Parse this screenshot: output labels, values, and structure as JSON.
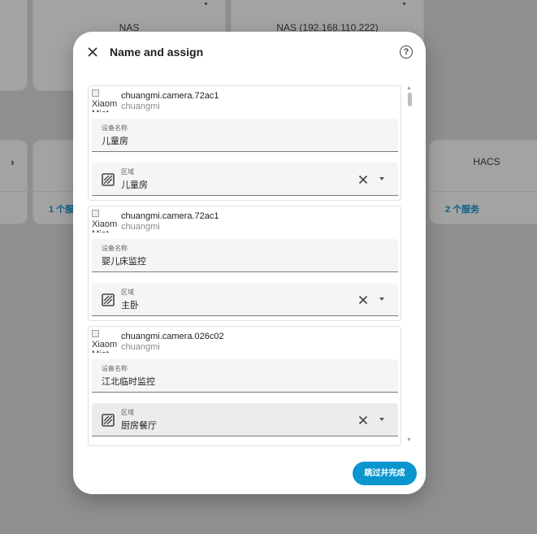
{
  "background": {
    "cards": [
      {
        "title": "NAS"
      },
      {
        "title": "NAS (192.168.110.222)"
      },
      {
        "title": "HACS",
        "link": "2 个服务"
      }
    ],
    "partial_link": "1 个服"
  },
  "dialog": {
    "title": "Name and assign",
    "close_icon": "close-icon",
    "help_icon": "help-icon",
    "help_glyph": "?",
    "devices": [
      {
        "image_alt": "Xiaomi Miot",
        "name": "chuangmi.camera.72ac1",
        "manufacturer": "chuangmi",
        "name_field_label": "设备名称",
        "name_field_value": "儿童房",
        "area_field_label": "区域",
        "area_field_value": "儿童房"
      },
      {
        "image_alt": "Xiaomi Miot",
        "name": "chuangmi.camera.72ac1",
        "manufacturer": "chuangmi",
        "name_field_label": "设备名称",
        "name_field_value": "婴儿床监控",
        "area_field_label": "区域",
        "area_field_value": "主卧"
      },
      {
        "image_alt": "Xiaomi Miot",
        "name": "chuangmi.camera.026c02",
        "manufacturer": "chuangmi",
        "name_field_label": "设备名称",
        "name_field_value": "江北临时监控",
        "area_field_label": "区域",
        "area_field_value": "厨房餐厅"
      }
    ],
    "finish_button": "跳过并完成"
  },
  "colors": {
    "accent": "#0a95cf",
    "overlay": "#8f8f8f",
    "field_bg": "#f5f5f5"
  }
}
